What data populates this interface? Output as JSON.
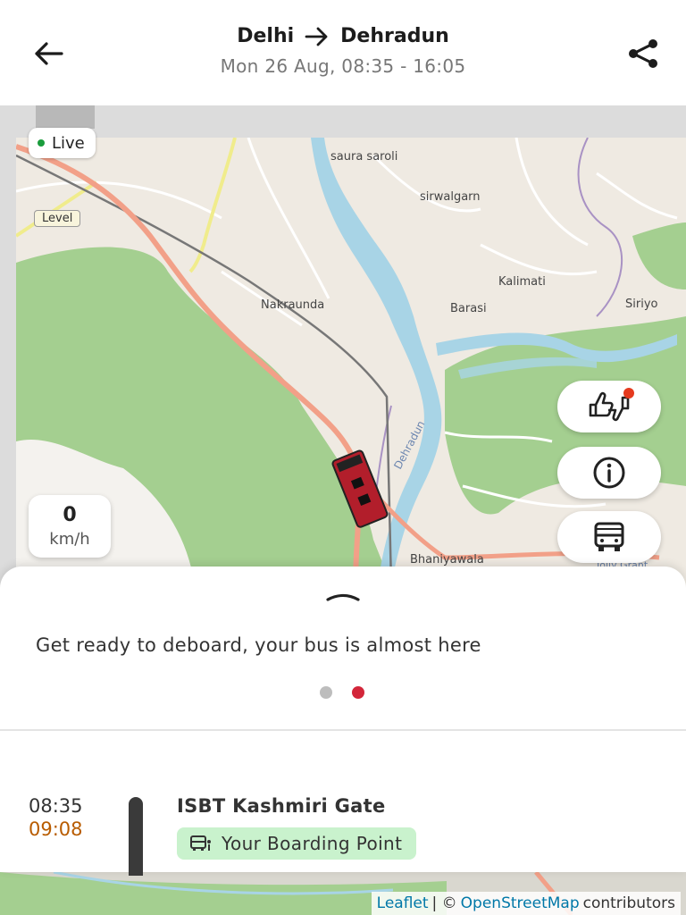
{
  "header": {
    "from": "Delhi",
    "to": "Dehradun",
    "schedule": "Mon 26 Aug, 08:35 - 16:05"
  },
  "map": {
    "live_label": "Live",
    "level_label": "Level",
    "places": {
      "saura_saroli": "saura saroli",
      "sirwalgarn": "sirwalgarn",
      "kalimati": "Kalimati",
      "barasi": "Barasi",
      "siriyo": "Siriyo",
      "nakraunda": "Nakraunda",
      "dehradun": "Dehradun",
      "bhaniyawala": "Bhaniyawala",
      "jolly_grant": "Jolly Grant"
    },
    "speed_value": "0",
    "speed_unit": "km/h"
  },
  "sheet": {
    "message": "Get ready to deboard, your bus is almost here",
    "page_indicator": {
      "active_index": 1,
      "count": 2
    }
  },
  "stop": {
    "scheduled_time": "08:35",
    "live_time": "09:08",
    "name": "ISBT Kashmiri Gate",
    "chip_label": "Your Boarding Point"
  },
  "attribution": {
    "leaflet": "Leaflet",
    "separator": "| ©",
    "osm": "OpenStreetMap",
    "contributors": "contributors"
  },
  "colors": {
    "accent_red": "#d3263a",
    "live_green": "#1a9c3c",
    "delay_orange": "#b85c00",
    "chip_green": "#c9f2cd",
    "map_land": "#efeae2",
    "map_forest": "#a4cf90",
    "map_river": "#a8d4e6",
    "map_road_major": "#f2a088"
  }
}
